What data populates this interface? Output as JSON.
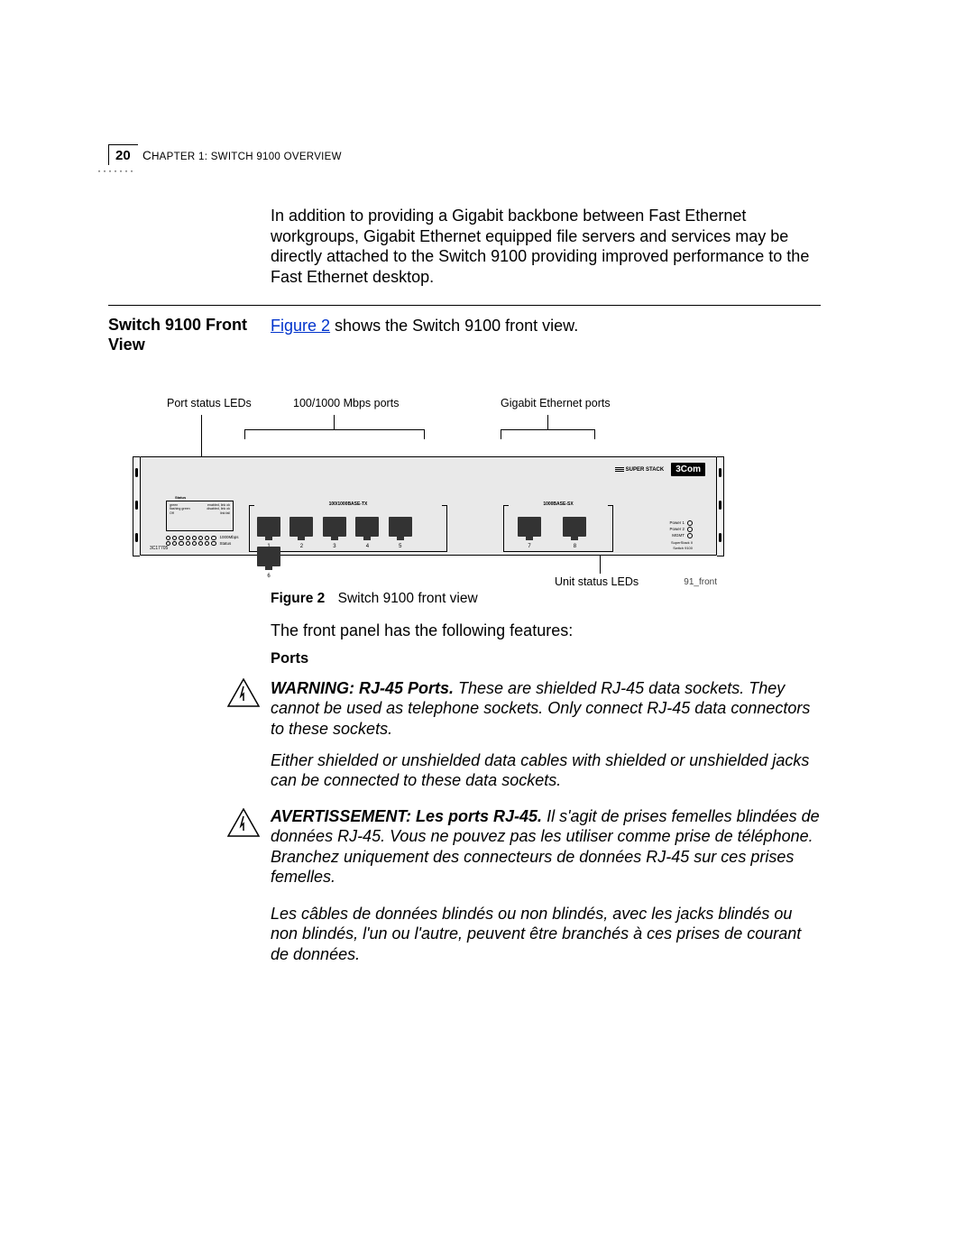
{
  "page_number": "20",
  "chapter_heading_prefix": "C",
  "chapter_heading_rest": "HAPTER 1: SWITCH 9100 OVERVIEW",
  "intro": "In addition to providing a Gigabit backbone between Fast Ethernet workgroups, Gigabit Ethernet equipped file servers and services may be directly attached to the Switch 9100 providing improved performance to the Fast Ethernet desktop.",
  "section_title": "Switch 9100 Front View",
  "figref_link": "Figure 2",
  "figref_rest": " shows the Switch 9100 front view.",
  "figure": {
    "labels": {
      "port_status_leds": "Port status LEDs",
      "mbps_ports": "100/1000 Mbps ports",
      "gig_ports": "Gigabit Ethernet ports",
      "unit_status_leds": "Unit status LEDs",
      "fig_id": "91_front"
    },
    "device": {
      "superstack": "SUPER STACK",
      "logo": "3Com",
      "product_code": "3C17705",
      "status_title": "Status",
      "status_rows": [
        [
          "green",
          "enabled, link ok"
        ],
        [
          "flashing green",
          "disabled, link ok"
        ],
        [
          "Off",
          "link fail"
        ]
      ],
      "led_label_top": "1000Mbps",
      "led_label_bottom": "Status",
      "group1_title": "100/1000BASE-TX",
      "group2_title": "1000BASE-SX",
      "port_numbers_g1": [
        "1",
        "2",
        "3",
        "4",
        "5",
        "6"
      ],
      "port_numbers_g2": [
        "7",
        "8"
      ],
      "unit_leds": [
        "Power 1",
        "Power 2",
        "MGMT"
      ],
      "unit_sublabel1": "SuperStack II",
      "unit_sublabel2": "Switch 9100"
    }
  },
  "figcaption_label": "Figure 2",
  "figcaption_text": "Switch 9100 front view",
  "features_line": "The front panel has the following features:",
  "ports_heading": "Ports",
  "warn1_lead": "WARNING: RJ-45 Ports.",
  "warn1_rest": " These are shielded RJ-45 data sockets. They cannot be used as telephone sockets. Only connect RJ-45 data connectors to these sockets.",
  "warn1_p2": "Either shielded or unshielded data cables with shielded or unshielded jacks can be connected to these data sockets.",
  "warn2_lead": "AVERTISSEMENT: Les ports RJ-45.",
  "warn2_rest": " Il s'agit de prises femelles blindées de données RJ-45. Vous ne pouvez pas les utiliser comme prise de téléphone. Branchez uniquement des connecteurs de données RJ-45 sur ces prises femelles.",
  "warn2_p2": "Les câbles de données blindés ou non blindés, avec les jacks blindés ou non blindés, l'un ou l'autre, peuvent être branchés à ces prises de courant de données."
}
